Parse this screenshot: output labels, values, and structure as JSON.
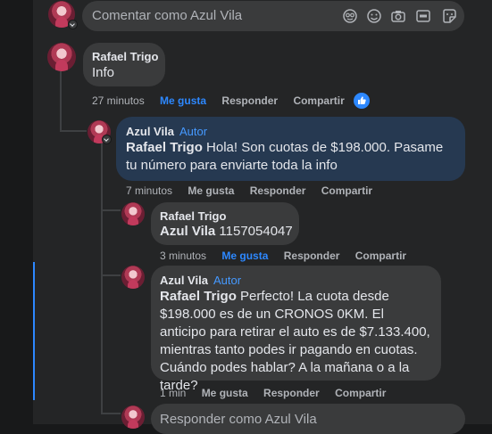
{
  "composer": {
    "placeholder": "Comentar como Azul Vila"
  },
  "comments": [
    {
      "author": "Rafael Trigo",
      "text": "Info",
      "time": "27 minutos",
      "like": "Me gusta",
      "reply": "Responder",
      "share": "Compartir",
      "liked": true
    },
    {
      "author": "Azul Vila",
      "author_tag": "Autor",
      "mention": "Rafael Trigo",
      "text": "Hola! Son cuotas de $198.000. Pasame tu número para enviarte toda la info",
      "time": "7 minutos",
      "like": "Me gusta",
      "reply": "Responder",
      "share": "Compartir"
    },
    {
      "author": "Rafael Trigo",
      "mention": "Azul Vila",
      "text": "1157054047",
      "time": "3 minutos",
      "like": "Me gusta",
      "reply": "Responder",
      "share": "Compartir",
      "liked": true
    },
    {
      "author": "Azul Vila",
      "author_tag": "Autor",
      "mention": "Rafael Trigo",
      "text": "Perfecto! La cuota desde $198.000 es de un CRONOS 0KM. El anticipo para retirar el auto es de $7.133.400, mientras tanto podes ir pagando en cuotas. Cuándo podes hablar? A la mañana o a la tarde?",
      "time": "1 min",
      "like": "Me gusta",
      "reply": "Responder",
      "share": "Compartir"
    }
  ],
  "reply_box": {
    "placeholder": "Responder como Azul Vila"
  },
  "colors": {
    "accent": "#2d88ff",
    "author_tag": "#4599ff",
    "bubble": "#3a3b3c",
    "bubble_highlight": "#263951"
  },
  "icons": [
    "avatar-icon",
    "emoji-icon",
    "smile-icon",
    "camera-icon",
    "gif-icon",
    "sticker-icon",
    "like-reaction-icon"
  ]
}
